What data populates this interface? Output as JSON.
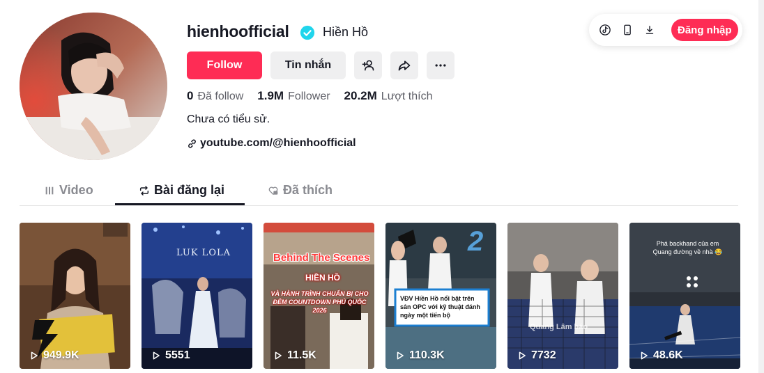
{
  "profile": {
    "username": "hienhoofficial",
    "nickname": "Hiền Hồ",
    "bio": "Chưa có tiểu sử.",
    "link": "youtube.com/@hienhoofficial"
  },
  "actions": {
    "follow_label": "Follow",
    "message_label": "Tin nhắn"
  },
  "stats": [
    {
      "value": "0",
      "label": "Đã follow"
    },
    {
      "value": "1.9M",
      "label": "Follower"
    },
    {
      "value": "20.2M",
      "label": "Lượt thích"
    }
  ],
  "top_right": {
    "login_label": "Đăng nhập"
  },
  "tabs": [
    {
      "label": "Video"
    },
    {
      "label": "Bài đăng lại"
    },
    {
      "label": "Đã thích"
    }
  ],
  "active_tab": "Bài đăng lại",
  "videos": [
    {
      "views": "949.9K"
    },
    {
      "views": "5551",
      "overlay": "LUK LOLA"
    },
    {
      "views": "11.5K",
      "overlay_title": "Behind The Scenes",
      "overlay_name": "HIỀN HỒ",
      "overlay_sub": "VÀ HÀNH TRÌNH CHUẨN BỊ CHO ĐÊM COUNTDOWN PHÚ QUỐC 2026"
    },
    {
      "views": "110.3K",
      "overlay": "VĐV Hiền Hồ nổi bật trên sân OPC với kỹ thuật đánh ngày một tiến bộ"
    },
    {
      "views": "7732",
      "overlay": "Quang Lâm báo"
    },
    {
      "views": "48.6K",
      "overlay": "Phá backhand của em Quang đường về nhà 😂"
    }
  ],
  "colors": {
    "brand": "#fe2c55",
    "verified": "#20d5ec",
    "text_primary": "#161823",
    "text_secondary": "#5d5e66",
    "button_gray": "#efeff0"
  }
}
